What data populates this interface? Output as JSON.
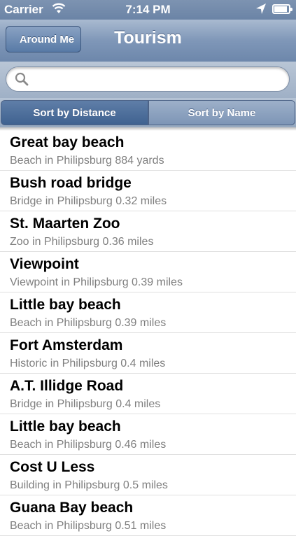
{
  "status_bar": {
    "carrier": "Carrier",
    "time": "7:14 PM",
    "icons": [
      "wifi-icon",
      "location-arrow-icon",
      "battery-icon"
    ]
  },
  "nav": {
    "back_label": "Around Me",
    "title": "Tourism"
  },
  "search": {
    "placeholder": "",
    "value": ""
  },
  "sort": {
    "distance_label": "Sort by Distance",
    "name_label": "Sort by Name",
    "selected": "distance"
  },
  "places": [
    {
      "name": "Great bay beach",
      "detail": "Beach in Philipsburg 884 yards"
    },
    {
      "name": "Bush road bridge",
      "detail": "Bridge in Philipsburg 0.32 miles"
    },
    {
      "name": "St. Maarten Zoo",
      "detail": "Zoo in Philipsburg 0.36 miles"
    },
    {
      "name": "Viewpoint",
      "detail": "Viewpoint in Philipsburg 0.39 miles"
    },
    {
      "name": "Little bay beach",
      "detail": "Beach in Philipsburg 0.39 miles"
    },
    {
      "name": "Fort Amsterdam",
      "detail": "Historic in Philipsburg 0.4 miles"
    },
    {
      "name": "A.T. Illidge Road",
      "detail": "Bridge in Philipsburg 0.4 miles"
    },
    {
      "name": "Little bay beach",
      "detail": "Beach in Philipsburg 0.46 miles"
    },
    {
      "name": "Cost U Less",
      "detail": "Building in Philipsburg 0.5 miles"
    },
    {
      "name": "Guana Bay beach",
      "detail": "Beach in Philipsburg 0.51 miles"
    }
  ]
}
